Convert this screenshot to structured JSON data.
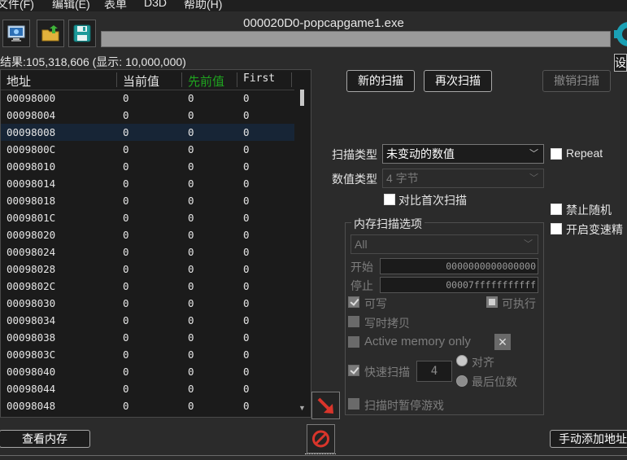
{
  "menu": {
    "items": [
      "文件(F)",
      "编辑(E)",
      "表单",
      "D3D",
      "帮助(H)"
    ]
  },
  "toolbar": {
    "icons": [
      "computer-icon",
      "open-folder-icon",
      "save-disk-icon"
    ]
  },
  "process": {
    "title": "000020D0-popcapgame1.exe"
  },
  "settings": {
    "label": "设"
  },
  "results": {
    "found_text": "结果:105,318,606 (显示: 10,000,000)"
  },
  "table": {
    "headers": [
      "地址",
      "当前值",
      "先前值",
      "First"
    ],
    "header_colors": {
      "previous": "#1fa31f"
    },
    "rows": [
      [
        "00098000",
        "0",
        "0",
        "0"
      ],
      [
        "00098004",
        "0",
        "0",
        "0"
      ],
      [
        "00098008",
        "0",
        "0",
        "0"
      ],
      [
        "0009800C",
        "0",
        "0",
        "0"
      ],
      [
        "00098010",
        "0",
        "0",
        "0"
      ],
      [
        "00098014",
        "0",
        "0",
        "0"
      ],
      [
        "00098018",
        "0",
        "0",
        "0"
      ],
      [
        "0009801C",
        "0",
        "0",
        "0"
      ],
      [
        "00098020",
        "0",
        "0",
        "0"
      ],
      [
        "00098024",
        "0",
        "0",
        "0"
      ],
      [
        "00098028",
        "0",
        "0",
        "0"
      ],
      [
        "0009802C",
        "0",
        "0",
        "0"
      ],
      [
        "00098030",
        "0",
        "0",
        "0"
      ],
      [
        "00098034",
        "0",
        "0",
        "0"
      ],
      [
        "00098038",
        "0",
        "0",
        "0"
      ],
      [
        "0009803C",
        "0",
        "0",
        "0"
      ],
      [
        "00098040",
        "0",
        "0",
        "0"
      ],
      [
        "00098044",
        "0",
        "0",
        "0"
      ],
      [
        "00098048",
        "0",
        "0",
        "0"
      ]
    ],
    "selected_row": 2
  },
  "scan": {
    "new_scan": "新的扫描",
    "next_scan": "再次扫描",
    "undo_scan": "撤销扫描",
    "scan_type_label": "扫描类型",
    "scan_type_value": "未变动的数值",
    "value_type_label": "数值类型",
    "value_type_value": "4 字节",
    "compare_first": "对比首次扫描",
    "repeat": "Repeat",
    "disable_random": "禁止随机",
    "enable_speedhack": "开启变速精"
  },
  "memory": {
    "group_title": "内存扫描选项",
    "region_value": "All",
    "start_label": "开始",
    "start_value": "0000000000000000",
    "stop_label": "停止",
    "stop_value": "00007fffffffffff",
    "writable": "可写",
    "executable": "可执行",
    "copy_on_write": "写时拷贝",
    "active_memory": "Active memory only",
    "fast_scan": "快速扫描",
    "fast_scan_value": "4",
    "align": "对齐",
    "last_digits": "最后位数",
    "pause_game": "扫描时暂停游戏"
  },
  "bottom": {
    "view_memory": "查看内存",
    "add_address": "手动添加地址"
  },
  "colors": {
    "accent_red": "#d9352b",
    "selection": "#172536"
  }
}
